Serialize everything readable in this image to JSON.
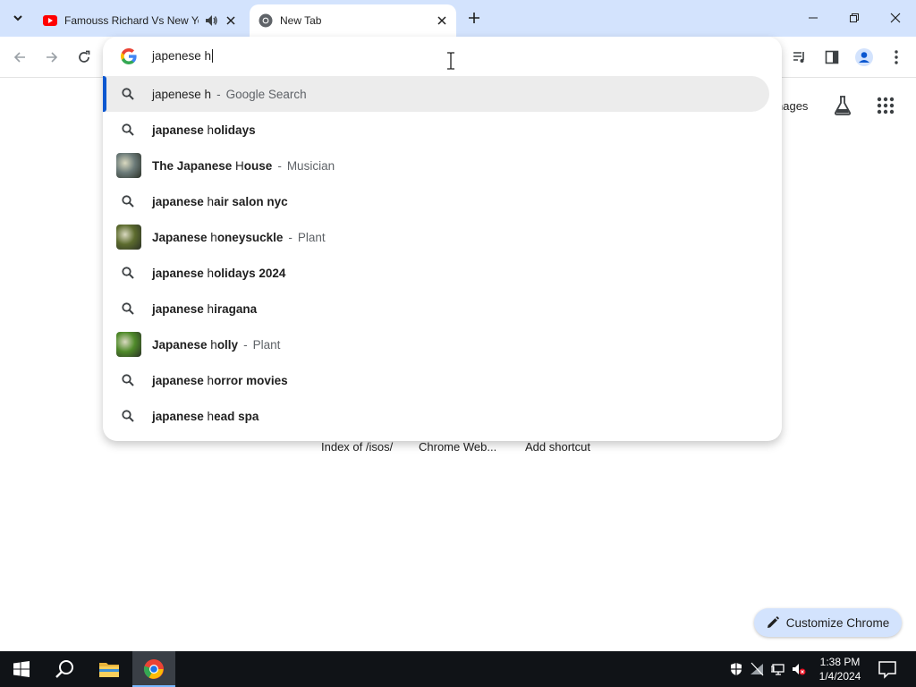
{
  "tabs": [
    {
      "title": "Famouss Richard Vs New Yo",
      "active": false,
      "audio": true,
      "favicon": "youtube-icon"
    },
    {
      "title": "New Tab",
      "active": true,
      "audio": false,
      "favicon": "chrome-icon"
    }
  ],
  "omnibox": {
    "input_value": "japenese h",
    "suggestions": [
      {
        "prefix": "japenese h",
        "bold": "",
        "sep": "-",
        "desc": "Google Search",
        "icon": "search-icon",
        "selected": true,
        "plain_prefix": true
      },
      {
        "prefix": "japanese ",
        "h": "h",
        "bold": "olidays",
        "sep": "",
        "desc": "",
        "icon": "search-icon"
      },
      {
        "prefix": "The Japanese ",
        "h": "H",
        "bold": "ouse",
        "sep": "-",
        "desc": "Musician",
        "icon": "thumbnail",
        "thumb_color": "#6b7a78"
      },
      {
        "prefix": "japanese ",
        "h": "h",
        "bold": "air salon nyc",
        "sep": "",
        "desc": "",
        "icon": "search-icon"
      },
      {
        "prefix": "Japanese ",
        "h": "h",
        "bold": "oneysuckle",
        "sep": "-",
        "desc": "Plant",
        "icon": "thumbnail",
        "thumb_color": "#5c6b2e"
      },
      {
        "prefix": "japanese ",
        "h": "h",
        "bold": "olidays 2024",
        "sep": "",
        "desc": "",
        "icon": "search-icon"
      },
      {
        "prefix": "japanese ",
        "h": "h",
        "bold": "iragana",
        "sep": "",
        "desc": "",
        "icon": "search-icon"
      },
      {
        "prefix": "Japanese ",
        "h": "h",
        "bold": "olly",
        "sep": "-",
        "desc": "Plant",
        "icon": "thumbnail",
        "thumb_color": "#4f8a2a"
      },
      {
        "prefix": "japanese ",
        "h": "h",
        "bold": "orror movies",
        "sep": "",
        "desc": "",
        "icon": "search-icon"
      },
      {
        "prefix": "japanese ",
        "h": "h",
        "bold": "ead spa",
        "sep": "",
        "desc": "",
        "icon": "search-icon"
      }
    ]
  },
  "ntp": {
    "images_label": "nages",
    "shortcuts": [
      "Index of /isos/",
      "Chrome Web...",
      "Add shortcut"
    ],
    "customize_label": "Customize Chrome"
  },
  "taskbar": {
    "time": "1:38 PM",
    "date": "1/4/2024"
  },
  "colors": {
    "tabstrip": "#d3e3fd",
    "accent": "#0b57d0",
    "taskbar": "#101317"
  }
}
